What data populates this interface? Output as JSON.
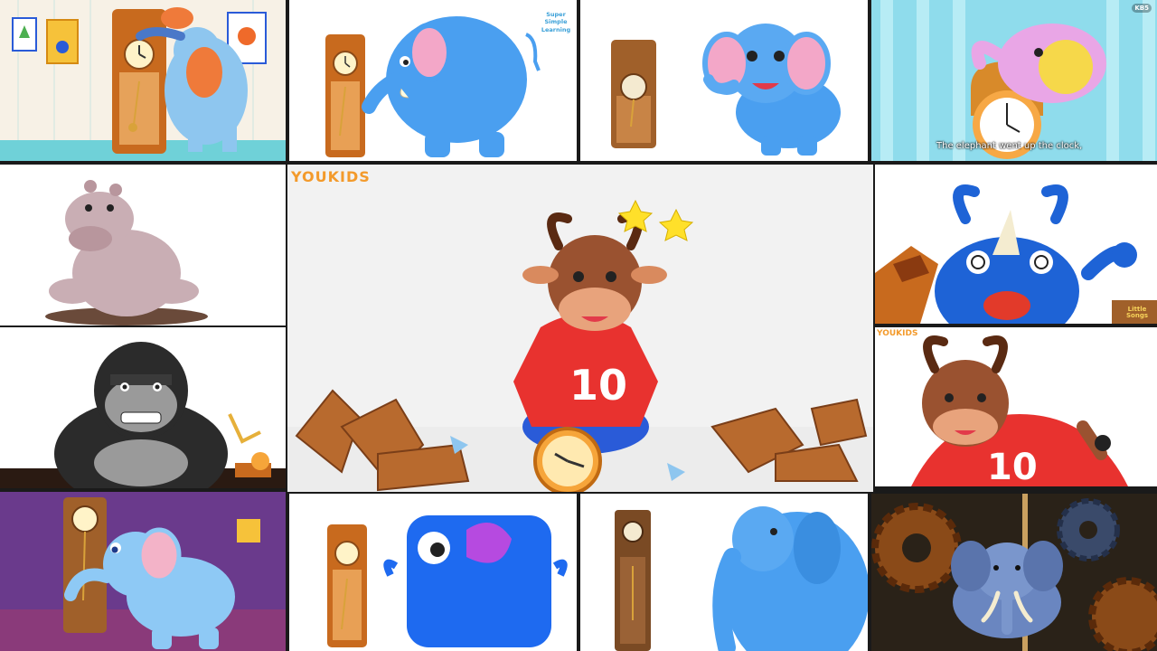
{
  "collage": {
    "tiles": [
      {
        "id": "t1",
        "subject": "elephant-hugging-grandfather-clock",
        "bg": "#f7f1e6",
        "wall_accent": "#bfe3df"
      },
      {
        "id": "t2",
        "subject": "blue-elephant-and-clock",
        "bg": "#ffffff",
        "watermark": "Super Simple Learning"
      },
      {
        "id": "t3",
        "subject": "cute-elephant-and-clock",
        "bg": "#ffffff"
      },
      {
        "id": "t4",
        "subject": "pink-elephant-on-clock",
        "bg": "#8fdcec",
        "caption": "The elephant went up the clock,",
        "badge": "KB5"
      },
      {
        "id": "t5",
        "subject": "hippo-sitting",
        "bg": "#ffffff"
      },
      {
        "id": "t6",
        "subject": "bull-sitting-on-broken-clock",
        "bg": "#f2f2f2",
        "watermark": "YOUKIDS",
        "shirt_number": "10"
      },
      {
        "id": "t7",
        "subject": "dizzy-blue-rhino",
        "bg": "#ffffff",
        "watermark": "Little Songs"
      },
      {
        "id": "t8",
        "subject": "gorilla",
        "bg": "#ffffff"
      },
      {
        "id": "t9",
        "subject": "angry-bull",
        "bg": "#ffffff",
        "watermark": "YOUKIDS",
        "shirt_number": "10"
      },
      {
        "id": "t10",
        "subject": "light-blue-elephant-purple-room",
        "bg": "#6a3a8c"
      },
      {
        "id": "t11",
        "subject": "blue-square-elephant-and-clock",
        "bg": "#ffffff"
      },
      {
        "id": "t12",
        "subject": "blue-elephant-and-tall-clock",
        "bg": "#ffffff"
      },
      {
        "id": "t13",
        "subject": "elephant-with-gears",
        "bg": "#2a2218"
      }
    ]
  },
  "colors": {
    "clock_wood": "#c86a1e",
    "clock_wood_dark": "#8a4a18",
    "clock_face": "#fff3c8",
    "elephant_blue": "#4a9ff0",
    "elephant_pink": "#f3a7c8",
    "bull_brown": "#9a5230",
    "shirt_red": "#e8322f",
    "shorts_blue": "#2a5bd8",
    "star_yellow": "#ffe02a",
    "rhino_blue": "#1e63d6",
    "gorilla_dark": "#2b2b2b",
    "gorilla_grey": "#9a9a9a",
    "hippo_mauve": "#c9aeb4",
    "youkids_orange": "#f39a2b"
  }
}
